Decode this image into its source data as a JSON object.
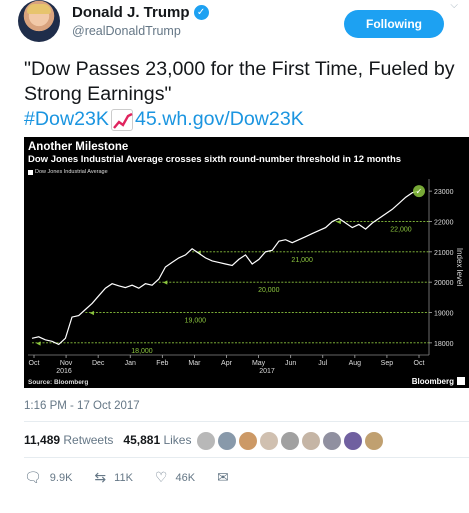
{
  "user": {
    "display_name": "Donald J. Trump",
    "handle": "@realDonaldTrump",
    "verified_mark": "✓"
  },
  "follow_button_label": "Following",
  "tweet": {
    "text": "\"Dow Passes 23,000 for the First Time, Fueled by Strong Earnings\"",
    "hashtag": "#Dow23K",
    "link": "45.wh.gov/Dow23K"
  },
  "chart_data": {
    "type": "line",
    "title": "Another Milestone",
    "subtitle": "Dow Jones Industrial Average crosses sixth round-number threshold in 12 months",
    "legend": [
      "Dow Jones Industrial Average"
    ],
    "ylabel": "Index level",
    "ylim": [
      17600,
      23400
    ],
    "yticks": [
      18000,
      19000,
      20000,
      21000,
      22000,
      23000
    ],
    "xticks": [
      "Oct",
      "Nov",
      "Dec",
      "Jan",
      "Feb",
      "Mar",
      "Apr",
      "May",
      "Jun",
      "Jul",
      "Aug",
      "Sep",
      "Oct"
    ],
    "xyears": [
      "2016",
      "2017"
    ],
    "threshold_labels": [
      "18,000",
      "19,000",
      "20,000",
      "21,000",
      "22,000"
    ],
    "source": "Source: Bloomberg",
    "brand": "Bloomberg",
    "series": [
      {
        "values": [
          18150,
          18200,
          18100,
          18050,
          17950,
          18150,
          18850,
          18900,
          19100,
          19300,
          19550,
          19800,
          19950,
          19880,
          19820,
          19900,
          19800,
          19950,
          19900,
          20100,
          20500,
          20650,
          20800,
          20900,
          21100,
          20950,
          20800,
          20700,
          20650,
          20600,
          20550,
          20750,
          20900,
          20600,
          20750,
          21000,
          21050,
          21350,
          21400,
          21300,
          21400,
          21500,
          21600,
          21700,
          21800,
          22000,
          22100,
          21950,
          21800,
          21900,
          21750,
          21950,
          22100,
          22250,
          22400,
          22600,
          22800,
          22950,
          23000
        ]
      }
    ],
    "line_color": "#ffffff",
    "threshold_color": "#8cc63f",
    "background": "#000000"
  },
  "timestamp": "1:16 PM - 17 Oct 2017",
  "stats": {
    "retweets_count": "11,489",
    "retweets_label": "Retweets",
    "likes_count": "45,881",
    "likes_label": "Likes"
  },
  "likers": [
    "#b8b8b8",
    "#8899aa",
    "#cc9966",
    "#d0c0b0",
    "#a0a0a0",
    "#c5b5a5",
    "#9090a0",
    "#7060a0",
    "#c0a070"
  ],
  "actions": {
    "reply_icon": "reply-icon",
    "reply_count": "9.9K",
    "retweet_icon": "retweet-icon",
    "retweet_count": "11K",
    "like_icon": "heart-icon",
    "like_count": "46K",
    "dm_icon": "envelope-icon"
  }
}
